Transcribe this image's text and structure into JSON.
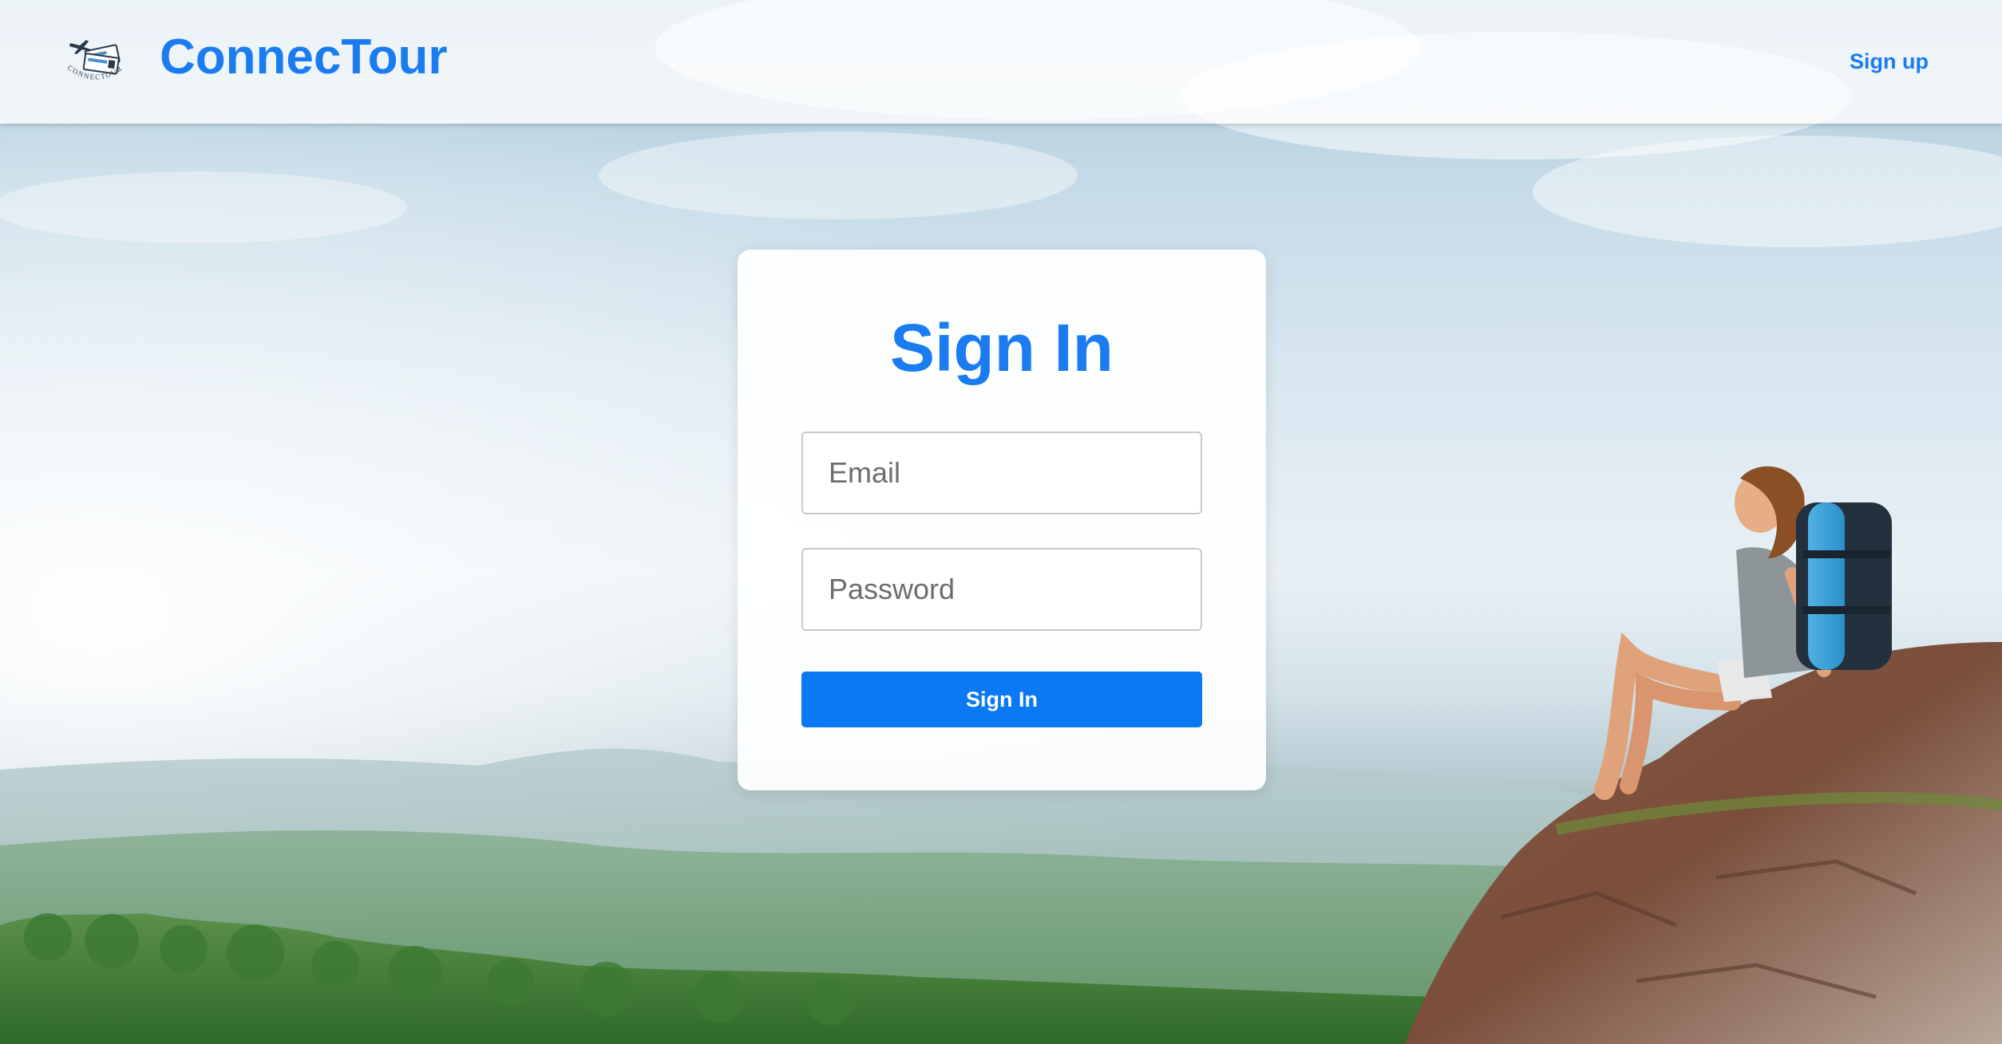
{
  "header": {
    "brand": "ConnecTour",
    "logo_text": "CONNECTOUR",
    "logo_icon": "tickets-plane-logo",
    "signup_label": "Sign up"
  },
  "signin": {
    "title": "Sign In",
    "email_placeholder": "Email",
    "email_value": "",
    "password_placeholder": "Password",
    "password_value": "",
    "submit_label": "Sign In"
  },
  "colors": {
    "accent": "#1a7cf0",
    "button": "#0b78f4"
  }
}
